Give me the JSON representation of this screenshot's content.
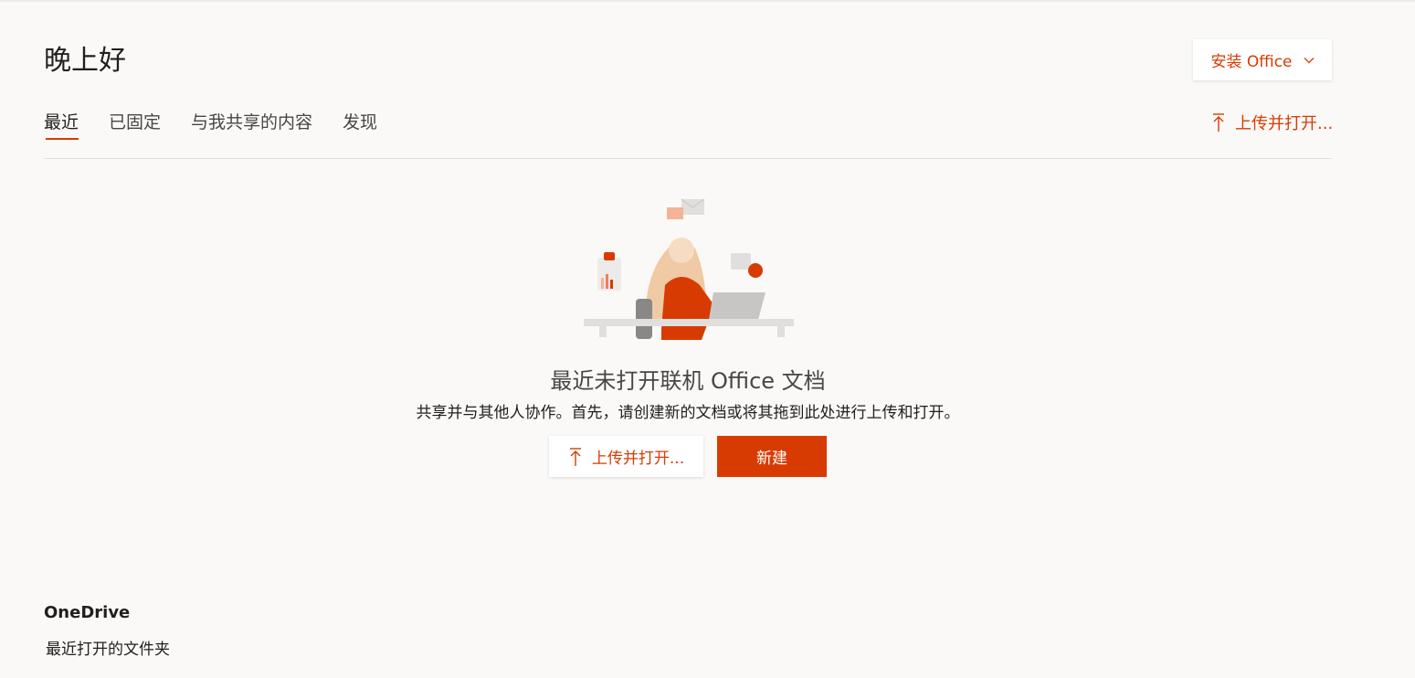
{
  "greeting": "晚上好",
  "install_button": {
    "label": "安装 Office",
    "icon": "chevron-down-icon"
  },
  "tabs": [
    {
      "label": "最近",
      "active": true
    },
    {
      "label": "已固定",
      "active": false
    },
    {
      "label": "与我共享的内容",
      "active": false
    },
    {
      "label": "发现",
      "active": false
    }
  ],
  "upload_top": {
    "label": "上传并打开...",
    "icon": "upload-icon"
  },
  "empty_state": {
    "title": "最近未打开联机 Office 文档",
    "subtitle": "共享并与其他人协作。首先，请创建新的文档或将其拖到此处进行上传和打开。",
    "upload_label": "上传并打开...",
    "new_label": "新建"
  },
  "onedrive": {
    "title": "OneDrive",
    "subtitle": "最近打开的文件夹"
  },
  "colors": {
    "accent": "#d83b01",
    "background": "#faf9f8"
  }
}
